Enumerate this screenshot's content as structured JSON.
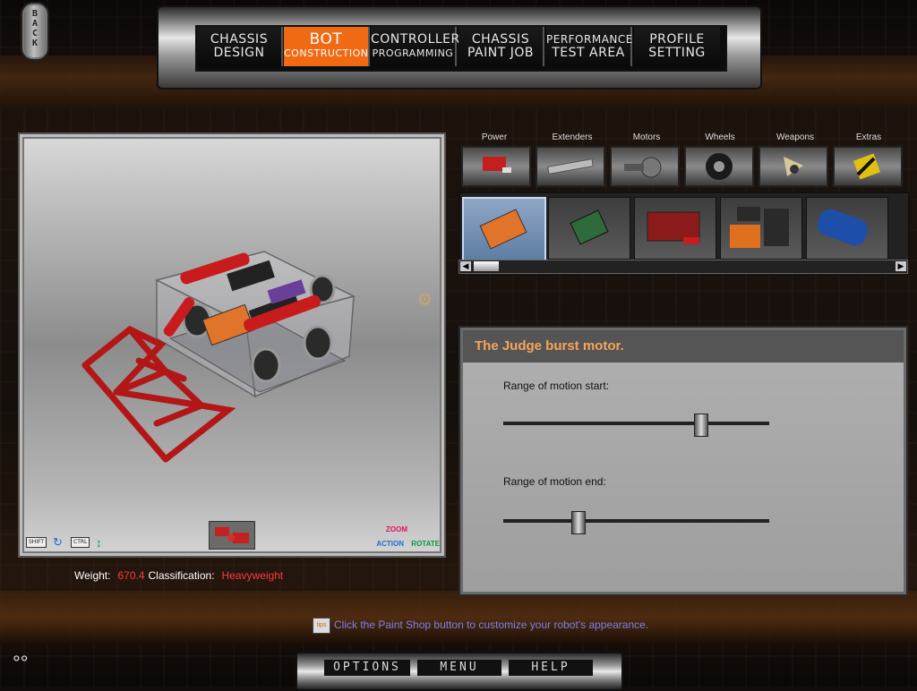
{
  "back_button": {
    "label": "BACK"
  },
  "nav": [
    {
      "l1": "CHASSIS",
      "l2": "DESIGN",
      "active": false
    },
    {
      "l1": "BOT",
      "l2": "CONSTRUCTION",
      "active": true
    },
    {
      "l1": "CONTROLLER",
      "l2": "PROGRAMMING",
      "active": false
    },
    {
      "l1": "CHASSIS",
      "l2": "PAINT JOB",
      "active": false
    },
    {
      "l1": "PERFORMANCE",
      "l2": "TEST AREA",
      "active": false
    },
    {
      "l1": "PROFILE",
      "l2": "SETTING",
      "active": false
    }
  ],
  "viewport": {
    "shift_key": "SHIFT",
    "ctrl_key": "CTRL",
    "zoom_label": "ZOOM",
    "action_label": "ACTION",
    "rotate_label": "ROTATE"
  },
  "stats": {
    "weight_label": "Weight:",
    "weight_value": "670.4",
    "class_label": "Classification:",
    "class_value": "Heavyweight"
  },
  "categories": [
    "Power",
    "Extenders",
    "Motors",
    "Wheels",
    "Weapons",
    "Extras"
  ],
  "parts": [
    "burst-motor-part",
    "circuit-board-part",
    "red-motor-part",
    "battery-pack-part",
    "puma-motor-part"
  ],
  "settings": {
    "title": "The Judge burst motor.",
    "start_label": "Range of motion start:",
    "start_value": 0.74,
    "end_label": "Range of motion end:",
    "end_value": 0.28
  },
  "tip": {
    "icon_text": "tips",
    "text": "Click the Paint Shop button to customize your robot's appearance."
  },
  "bottom": {
    "options": "OPTIONS",
    "menu": "MENU",
    "help": "HELP"
  }
}
